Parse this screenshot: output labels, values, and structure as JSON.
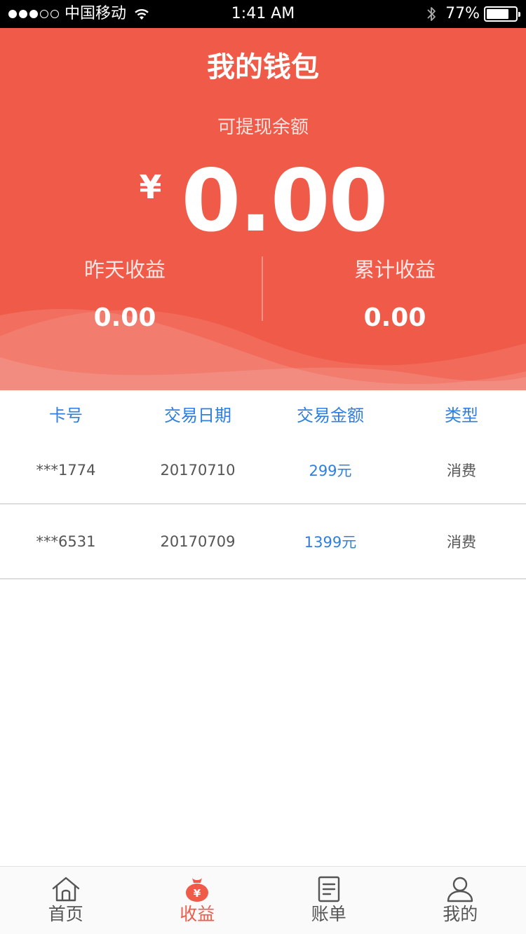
{
  "status_bar": {
    "carrier": "中国移动",
    "time": "1:41 AM",
    "battery_text": "77%",
    "battery_level": 0.77,
    "signal_bars_filled": 3,
    "signal_bars_total": 5
  },
  "header": {
    "title": "我的钱包",
    "balance_label": "可提现余额",
    "currency_symbol": "¥",
    "balance": "0.00",
    "yesterday_label": "昨天收益",
    "yesterday_value": "0.00",
    "total_label": "累计收益",
    "total_value": "0.00",
    "bg_color": "#f05a48"
  },
  "table": {
    "columns": [
      "卡号",
      "交易日期",
      "交易金额",
      "类型"
    ],
    "rows": [
      {
        "card": "***1774",
        "date": "20170710",
        "amount": "299元",
        "type": "消费"
      },
      {
        "card": "***6531",
        "date": "20170709",
        "amount": "1399元",
        "type": "消费"
      }
    ],
    "header_color": "#2f7ee0"
  },
  "tabbar": {
    "tabs": [
      {
        "label": "首页",
        "icon": "home-icon"
      },
      {
        "label": "收益",
        "icon": "money-bag-icon",
        "active": true
      },
      {
        "label": "账单",
        "icon": "bill-icon"
      },
      {
        "label": "我的",
        "icon": "profile-icon"
      }
    ],
    "active_color": "#f05a48"
  }
}
